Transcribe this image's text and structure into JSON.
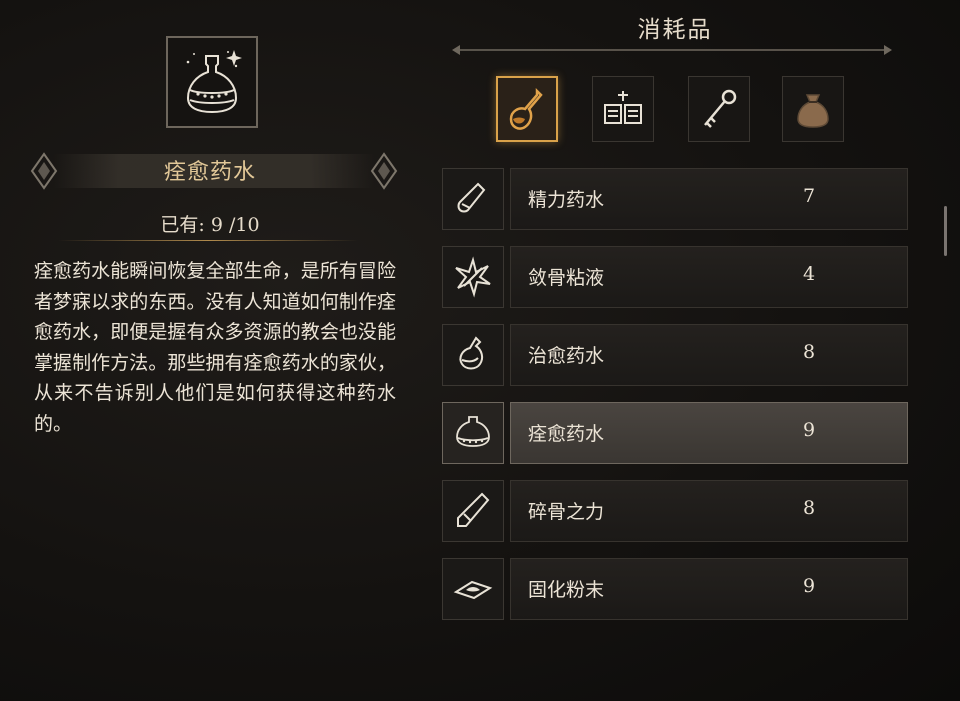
{
  "detail": {
    "item_name": "痊愈药水",
    "owned_text": "已有: 9 /10",
    "description": "痊愈药水能瞬间恢复全部生命，是所有冒险者梦寐以求的东西。没有人知道如何制作痊愈药水，即便是握有众多资源的教会也没能掌握制作方法。那些拥有痊愈药水的家伙，从来不告诉别人他们是如何获得这种药水的。",
    "icon": "flask-icon"
  },
  "category": {
    "title": "消耗品",
    "tabs": [
      {
        "icon": "potion-icon",
        "active": true
      },
      {
        "icon": "book-icon",
        "active": false
      },
      {
        "icon": "key-icon",
        "active": false
      },
      {
        "icon": "bag-icon",
        "active": false
      }
    ]
  },
  "items": [
    {
      "name": "精力药水",
      "count": "7",
      "icon": "vial-icon",
      "selected": false
    },
    {
      "name": "敛骨粘液",
      "count": "4",
      "icon": "burst-icon",
      "selected": false
    },
    {
      "name": "治愈药水",
      "count": "8",
      "icon": "bottle-icon",
      "selected": false
    },
    {
      "name": "痊愈药水",
      "count": "9",
      "icon": "flask-icon",
      "selected": true
    },
    {
      "name": "碎骨之力",
      "count": "8",
      "icon": "crystal-icon",
      "selected": false
    },
    {
      "name": "固化粉末",
      "count": "9",
      "icon": "powder-icon",
      "selected": false
    }
  ],
  "colors": {
    "accent": "#d9a24a",
    "title_gold": "#e2c898",
    "selected_row": "#46413c"
  }
}
